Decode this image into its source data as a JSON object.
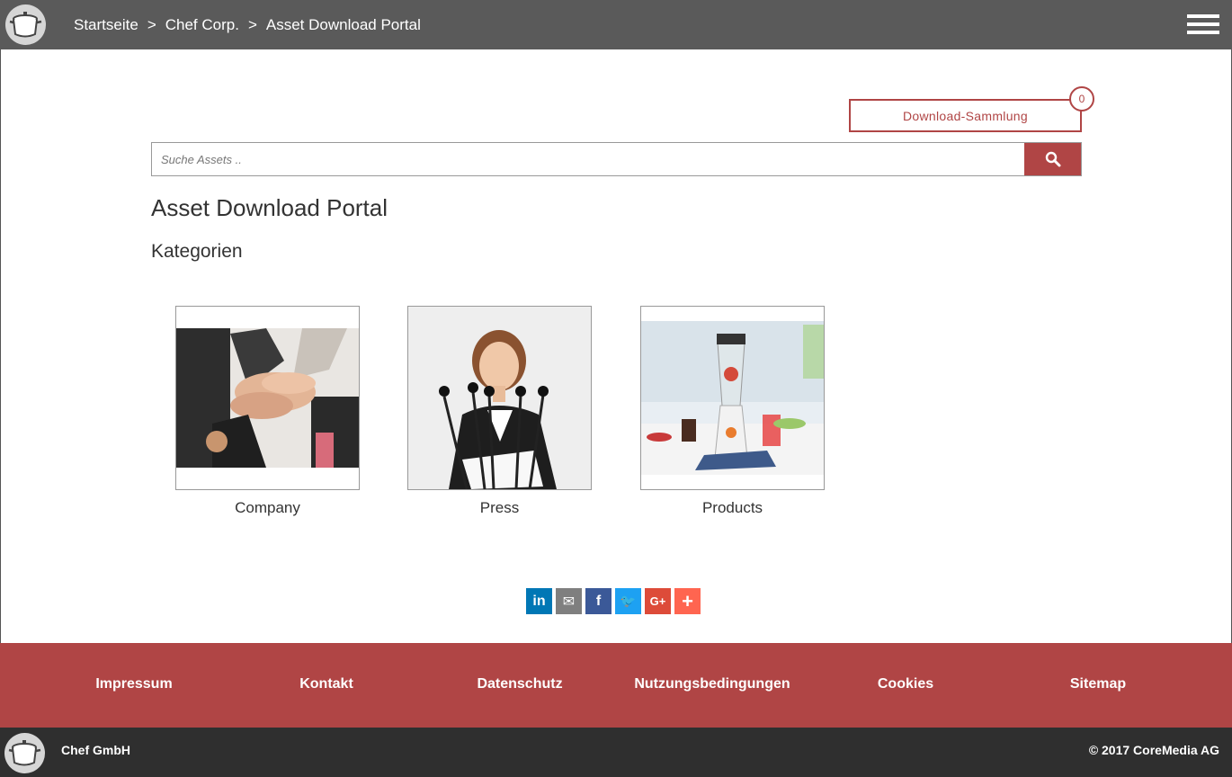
{
  "header": {
    "logo_icon": "cooking-pot-icon",
    "breadcrumb": [
      "Startseite",
      "Chef Corp.",
      "Asset Download Portal"
    ],
    "separator": ">",
    "menu_icon": "hamburger-menu-icon"
  },
  "download_collection": {
    "label": "Download-Sammlung",
    "count": "0"
  },
  "search": {
    "placeholder": "Suche Assets ..",
    "button_icon": "search-icon"
  },
  "page_title": "Asset Download Portal",
  "section_title": "Kategorien",
  "categories": [
    {
      "label": "Company",
      "image": "teamwork-hands-photo"
    },
    {
      "label": "Press",
      "image": "press-conference-photo"
    },
    {
      "label": "Products",
      "image": "blender-kitchen-photo"
    }
  ],
  "social": [
    {
      "name": "linkedin",
      "glyph": "in",
      "color": "#0077b5"
    },
    {
      "name": "email",
      "glyph": "✉",
      "color": "#7f7f7f"
    },
    {
      "name": "facebook",
      "glyph": "f",
      "color": "#3b5998"
    },
    {
      "name": "twitter",
      "glyph": "🐦",
      "color": "#1da1f2"
    },
    {
      "name": "google-plus",
      "glyph": "G+",
      "color": "#dd4b39"
    },
    {
      "name": "more",
      "glyph": "+",
      "color": "#ff6550"
    }
  ],
  "footer": {
    "links": [
      "Impressum",
      "Kontakt",
      "Datenschutz",
      "Nutzungsbedingungen",
      "Cookies",
      "Sitemap"
    ],
    "company": "Chef GmbH",
    "copyright": "© 2017 CoreMedia AG"
  },
  "colors": {
    "header_bg": "#5a5a5a",
    "accent": "#b04545",
    "footer_dark": "#2f2f2f"
  }
}
